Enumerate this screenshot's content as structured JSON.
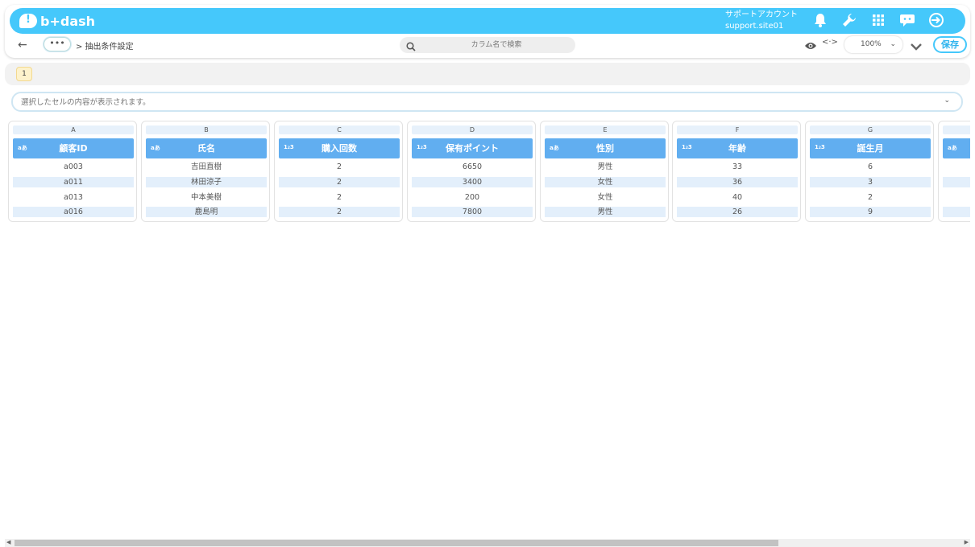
{
  "app": {
    "logo_text": "b+dash",
    "account_name": "サポートアカウント",
    "account_id": "support.site01"
  },
  "toolbar": {
    "back_icon": "back-arrow-icon",
    "more_label": "•••",
    "breadcrumb": "> 抽出条件設定",
    "search_placeholder": "カラム名で検索",
    "code_label": "<·>",
    "zoom_value": "100%",
    "save_label": "保存"
  },
  "sheets": {
    "tabs": [
      "1"
    ]
  },
  "cell_bar": {
    "placeholder": "選択したセルの内容が表示されます。"
  },
  "colors": {
    "banner": "#45c8fb",
    "column_header": "#61aef0",
    "row_alt": "#e3effb",
    "sheet_tab": "#fdf2cc"
  },
  "columns": [
    {
      "letter": "A",
      "type": "aあ",
      "name": "顧客ID",
      "cells": [
        "a003",
        "a011",
        "a013",
        "a016"
      ]
    },
    {
      "letter": "B",
      "type": "aあ",
      "name": "氏名",
      "cells": [
        "吉田直樹",
        "林田涼子",
        "中本美樹",
        "鹿島明"
      ]
    },
    {
      "letter": "C",
      "type": "1₂3",
      "name": "購入回数",
      "cells": [
        "2",
        "2",
        "2",
        "2"
      ]
    },
    {
      "letter": "D",
      "type": "1₂3",
      "name": "保有ポイント",
      "cells": [
        "6650",
        "3400",
        "200",
        "7800"
      ]
    },
    {
      "letter": "E",
      "type": "aあ",
      "name": "性別",
      "cells": [
        "男性",
        "女性",
        "女性",
        "男性"
      ]
    },
    {
      "letter": "F",
      "type": "1₂3",
      "name": "年齢",
      "cells": [
        "33",
        "36",
        "40",
        "26"
      ]
    },
    {
      "letter": "G",
      "type": "1₂3",
      "name": "誕生月",
      "cells": [
        "6",
        "3",
        "2",
        "9"
      ]
    },
    {
      "letter": "",
      "type": "aあ",
      "name": "",
      "cells": [
        "",
        "",
        "",
        ""
      ]
    }
  ]
}
